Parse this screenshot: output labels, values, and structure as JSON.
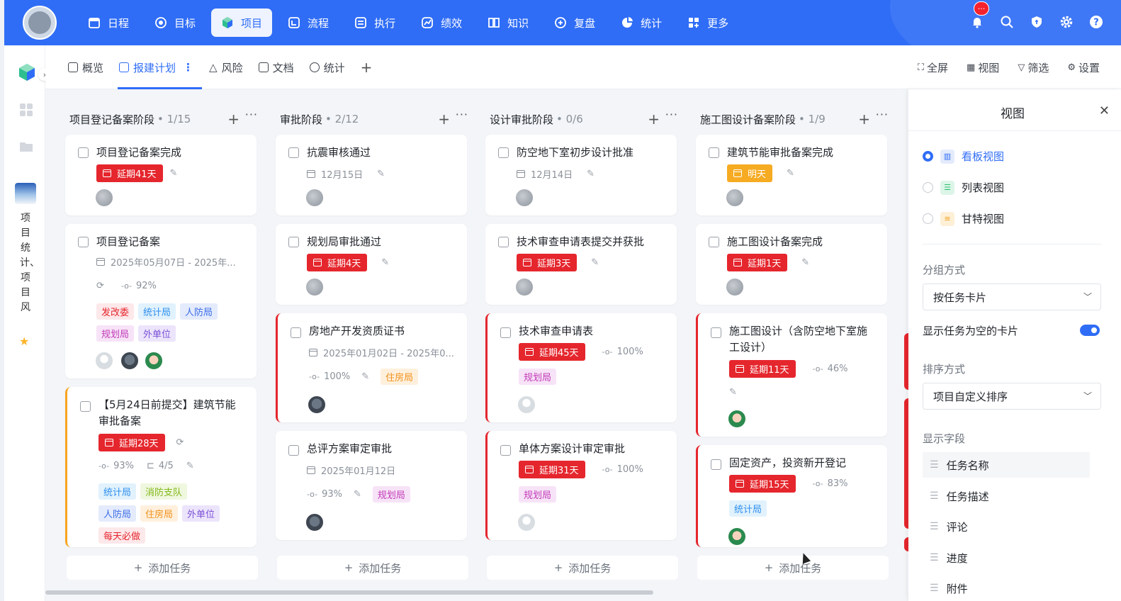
{
  "topnav": {
    "items": [
      {
        "label": "日程",
        "icon": "calendar-icon"
      },
      {
        "label": "目标",
        "icon": "target-icon"
      },
      {
        "label": "项目",
        "icon": "cube-icon",
        "active": true
      },
      {
        "label": "流程",
        "icon": "flow-icon"
      },
      {
        "label": "执行",
        "icon": "checklist-icon"
      },
      {
        "label": "绩效",
        "icon": "performance-icon"
      },
      {
        "label": "知识",
        "icon": "book-icon"
      },
      {
        "label": "复盘",
        "icon": "review-icon"
      },
      {
        "label": "统计",
        "icon": "pie-chart-icon"
      },
      {
        "label": "更多",
        "icon": "grid-plus-icon"
      }
    ],
    "notification_badge": "···",
    "accent": "#2f6df6"
  },
  "sidebar": {
    "project_name": "项目统计、项目风",
    "starred": true
  },
  "tabs": {
    "items": [
      {
        "label": "概览",
        "icon": "overview-icon"
      },
      {
        "label": "报建计划",
        "icon": "check-square-icon",
        "active": true
      },
      {
        "label": "风险",
        "icon": "warning-icon"
      },
      {
        "label": "文档",
        "icon": "document-icon"
      },
      {
        "label": "统计",
        "icon": "clock-chart-icon"
      }
    ],
    "more": "⋮",
    "add": "+",
    "actions": [
      {
        "label": "全屏",
        "icon": "fullscreen-icon"
      },
      {
        "label": "视图",
        "icon": "view-grid-icon"
      },
      {
        "label": "筛选",
        "icon": "filter-icon"
      },
      {
        "label": "设置",
        "icon": "gear-icon"
      }
    ]
  },
  "board": {
    "add_task_label": "添加任务",
    "columns": [
      {
        "title": "项目登记备案阶段",
        "count": "• 1/15",
        "cards": [
          {
            "title": "项目登记备案完成",
            "due": "延期41天"
          },
          {
            "title": "项目登记备案",
            "date": "2025年05月07日 - 2025年...",
            "progress": "92%",
            "tags": [
              "发改委",
              "统计局",
              "人防局",
              "规划局",
              "外单位"
            ]
          },
          {
            "title": "【5月24日前提交】建筑节能审批备案",
            "due": "延期28天",
            "progress": "93%",
            "subtasks": "4/5",
            "tags": [
              "统计局",
              "消防支队",
              "人防局",
              "住房局",
              "外单位",
              "每天必做"
            ]
          }
        ]
      },
      {
        "title": "审批阶段",
        "count": "• 2/12",
        "cards": [
          {
            "title": "抗震审核通过",
            "date": "12月15日"
          },
          {
            "title": "规划局审批通过",
            "due": "延期4天"
          },
          {
            "title": "房地产开发资质证书",
            "date": "2025年01月02日 - 2025年0...",
            "progress": "100%",
            "tags": [
              "住房局"
            ]
          },
          {
            "title": "总评方案审定审批",
            "date": "2025年01月12日",
            "progress": "93%",
            "tags": [
              "规划局"
            ]
          }
        ]
      },
      {
        "title": "设计审批阶段",
        "count": "• 0/6",
        "cards": [
          {
            "title": "防空地下室初步设计批准",
            "date": "12月14日"
          },
          {
            "title": "技术审查申请表提交并获批",
            "due": "延期3天"
          },
          {
            "title": "技术审查申请表",
            "due": "延期45天",
            "progress": "100%",
            "tags": [
              "规划局"
            ]
          },
          {
            "title": "单体方案设计审定审批",
            "due": "延期31天",
            "progress": "100%",
            "tags": [
              "规划局"
            ]
          }
        ]
      },
      {
        "title": "施工图设计备案阶段",
        "count": "• 1/9",
        "cards": [
          {
            "title": "建筑节能审批备案完成",
            "due": "明天"
          },
          {
            "title": "施工图设计备案完成",
            "due": "延期1天"
          },
          {
            "title": "施工图设计（含防空地下室施工设计）",
            "due": "延期11天",
            "progress": "46%"
          },
          {
            "title": "固定资产，投资新开登记",
            "due": "延期15天",
            "progress": "83%",
            "tags": [
              "统计局"
            ]
          }
        ]
      }
    ]
  },
  "panel": {
    "title": "视图",
    "views": [
      {
        "label": "看板视图",
        "selected": true
      },
      {
        "label": "列表视图",
        "selected": false
      },
      {
        "label": "甘特视图",
        "selected": false
      }
    ],
    "group_label": "分组方式",
    "group_value": "按任务卡片",
    "show_empty_label": "显示任务为空的卡片",
    "show_empty_on": true,
    "sort_label": "排序方式",
    "sort_value": "项目自定义排序",
    "fields_label": "显示字段",
    "fields": [
      "任务名称",
      "任务描述",
      "评论",
      "进度",
      "附件"
    ]
  }
}
